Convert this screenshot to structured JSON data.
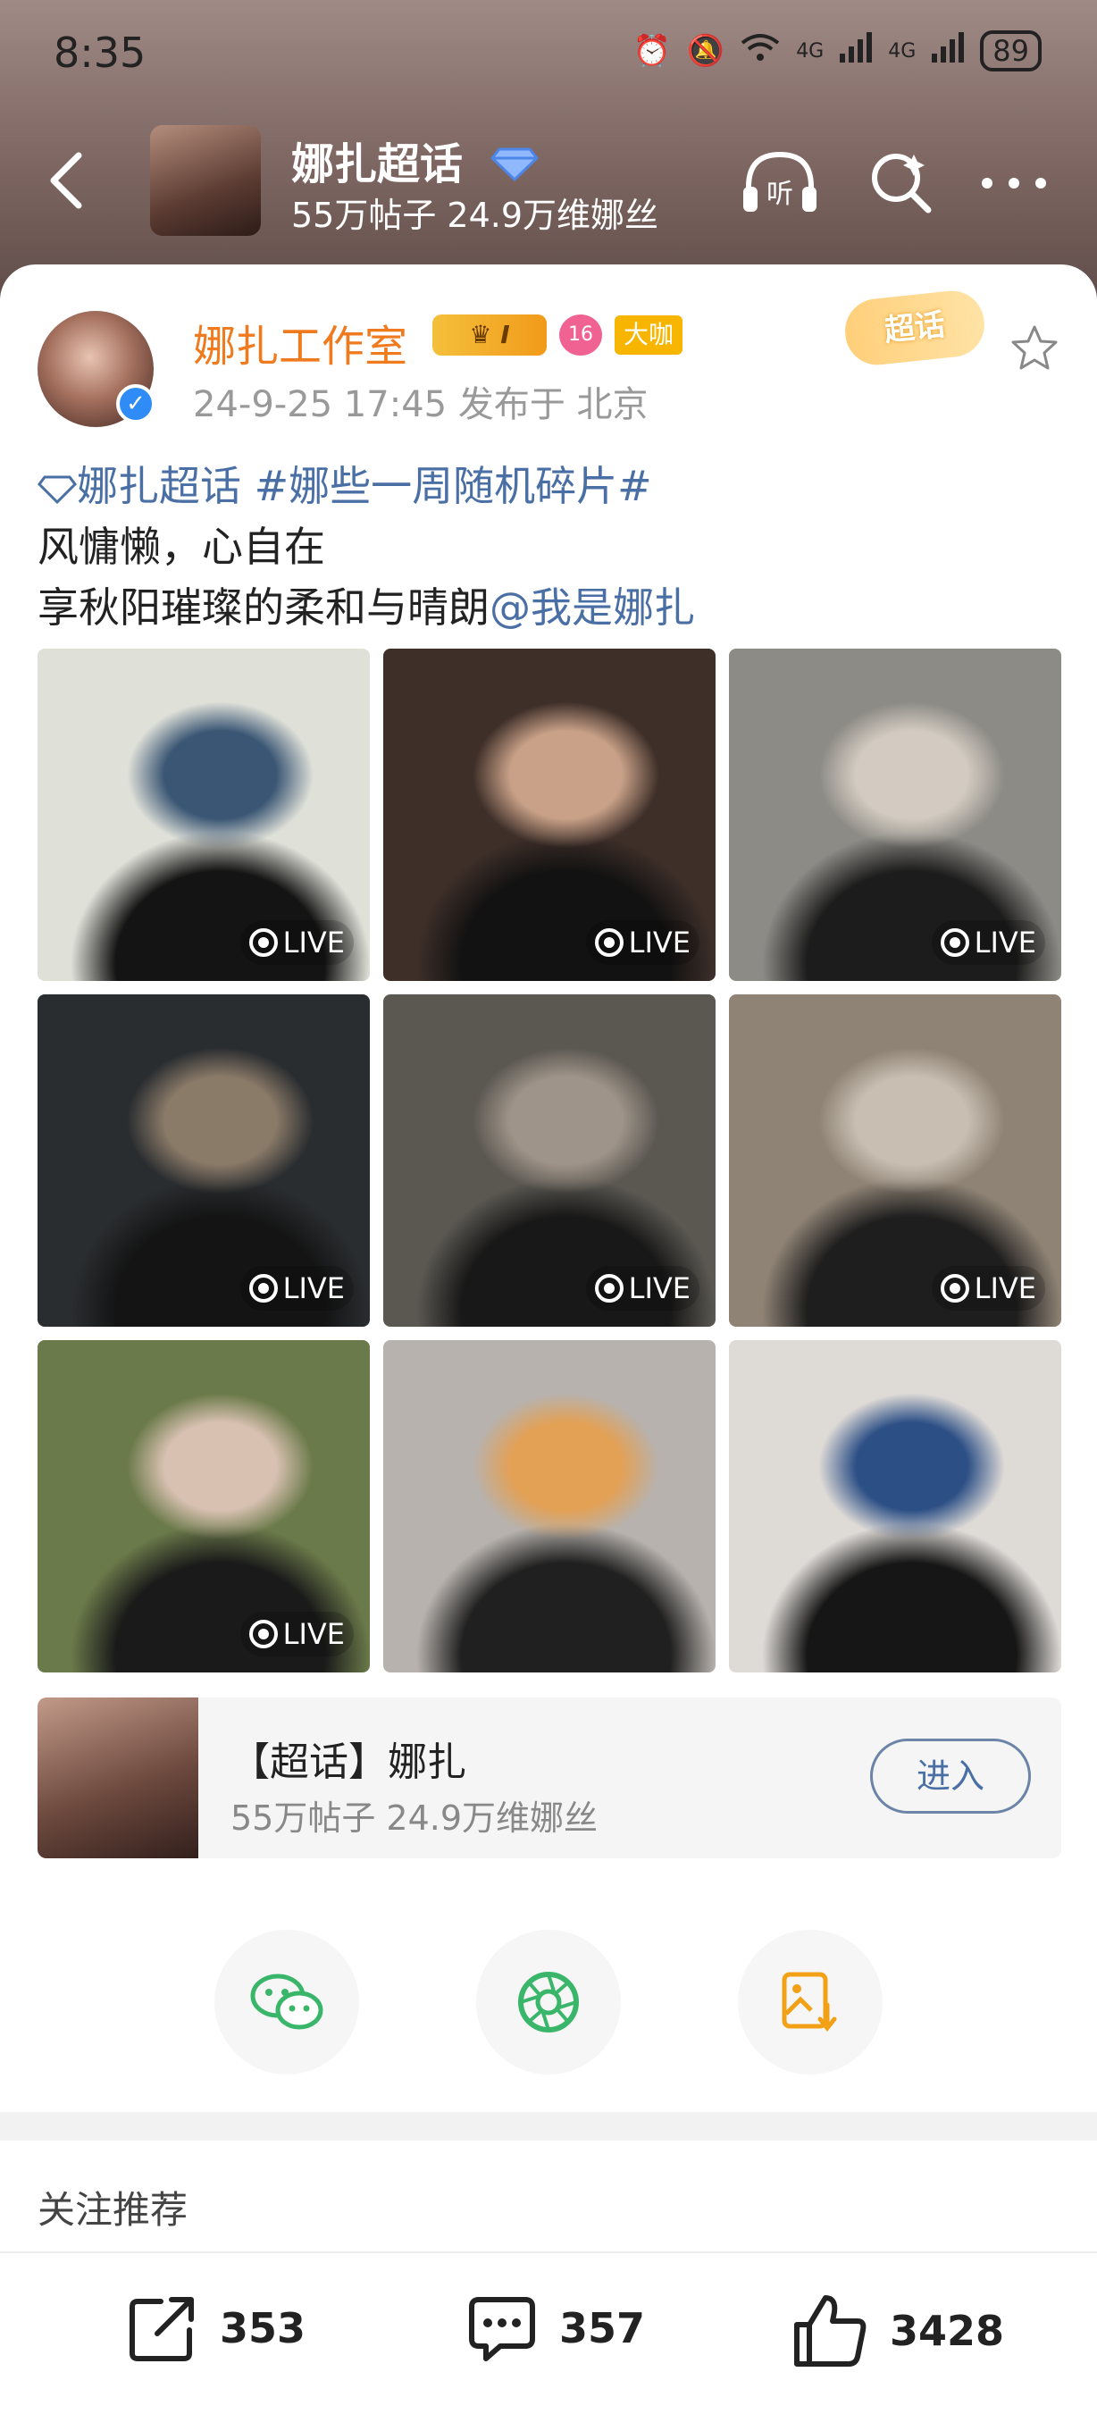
{
  "status_bar": {
    "time": "8:35",
    "signal1": "4G",
    "signal2": "4G",
    "battery": "89"
  },
  "header": {
    "title": "娜扎超话",
    "subtitle": "55万帖子 24.9万维娜丝",
    "listen_label": "听"
  },
  "post": {
    "author": "娜扎工作室",
    "badge_level": "I",
    "badge_lv_num": "16",
    "badge_dk": "大咖",
    "meta": "24-9-25 17:45  发布于 北京",
    "tag_label": "超话",
    "topic_link": "娜扎超话",
    "hashtag": "#娜些一周随机碎片#",
    "line2": "风慵懒，心自在",
    "line3": "享秋阳璀璨的柔和与晴朗",
    "mention": "@我是娜扎",
    "live_label": "LIVE"
  },
  "photos": [
    {
      "live": true,
      "colors": [
        "#dfe0d8",
        "#3a5674",
        "#141414"
      ]
    },
    {
      "live": true,
      "colors": [
        "#3e2f29",
        "#c9a188",
        "#121212"
      ]
    },
    {
      "live": true,
      "colors": [
        "#8d8b86",
        "#d3cbc1",
        "#1c1c1c"
      ]
    },
    {
      "live": true,
      "colors": [
        "#2a2d30",
        "#8a7a68",
        "#141414"
      ]
    },
    {
      "live": true,
      "colors": [
        "#5b5852",
        "#9f9489",
        "#181818"
      ]
    },
    {
      "live": true,
      "colors": [
        "#8f8375",
        "#c8bfb2",
        "#1e1e1e"
      ]
    },
    {
      "live": true,
      "colors": [
        "#6b7a4a",
        "#d9c1b2",
        "#1a1a1a"
      ]
    },
    {
      "live": false,
      "colors": [
        "#b7b2ad",
        "#e3a156",
        "#202020"
      ]
    },
    {
      "live": false,
      "colors": [
        "#dedad6",
        "#2c4f86",
        "#161616"
      ]
    }
  ],
  "topic_card": {
    "title": "【超话】娜扎",
    "subtitle": "55万帖子 24.9万维娜丝",
    "enter_label": "进入"
  },
  "share": {
    "wechat": "wechat-icon",
    "moments": "moments-icon",
    "save": "save-image-icon"
  },
  "follow_recommend": "关注推荐",
  "actions": {
    "repost": "353",
    "comments": "357",
    "likes": "3428"
  }
}
